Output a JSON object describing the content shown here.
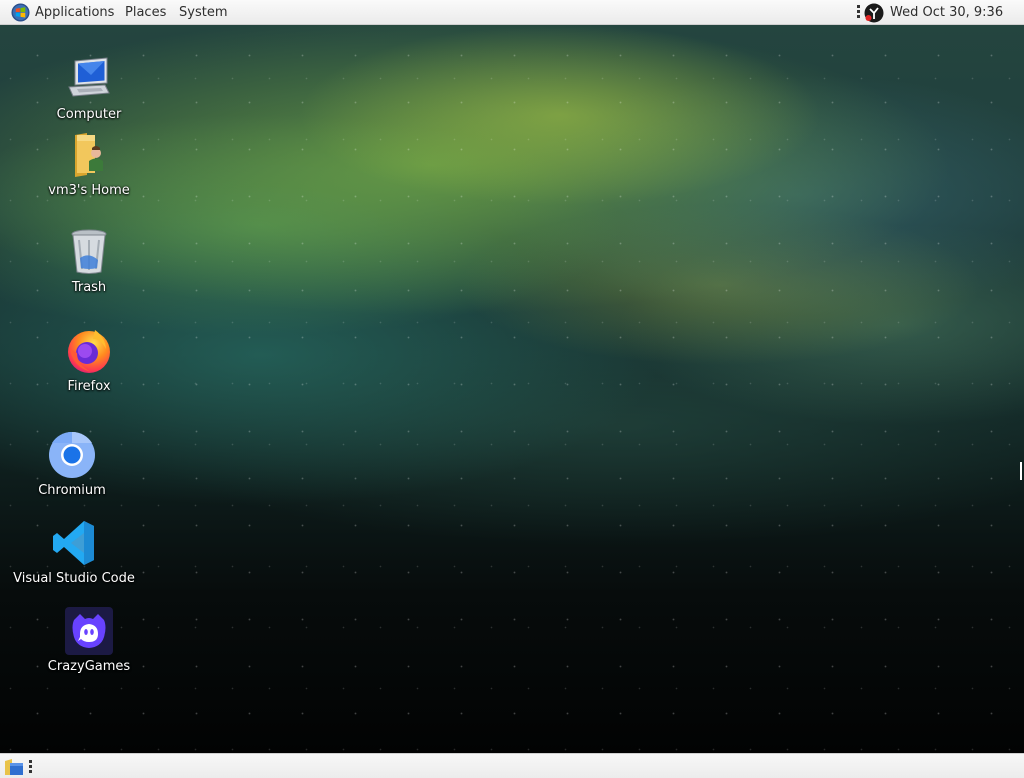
{
  "top_panel": {
    "menus": [
      {
        "label": "Applications"
      },
      {
        "label": "Places"
      },
      {
        "label": "System"
      }
    ],
    "clock": "Wed Oct 30,  9:36 AM"
  },
  "desktop": {
    "icons": [
      {
        "label": "Computer",
        "icon": "computer-icon"
      },
      {
        "label": "vm3's Home",
        "icon": "home-folder-icon"
      },
      {
        "label": "Trash",
        "icon": "trash-icon"
      },
      {
        "label": "Firefox",
        "icon": "firefox-icon"
      },
      {
        "label": "Chromium",
        "icon": "chromium-icon"
      },
      {
        "label": "Visual Studio Code",
        "icon": "vscode-icon"
      },
      {
        "label": "CrazyGames",
        "icon": "crazygames-icon"
      }
    ]
  },
  "colors": {
    "panel_bg": "#f0f0f0",
    "vscode_blue": "#23a9f2",
    "crazygames_purple": "#6842ff"
  }
}
